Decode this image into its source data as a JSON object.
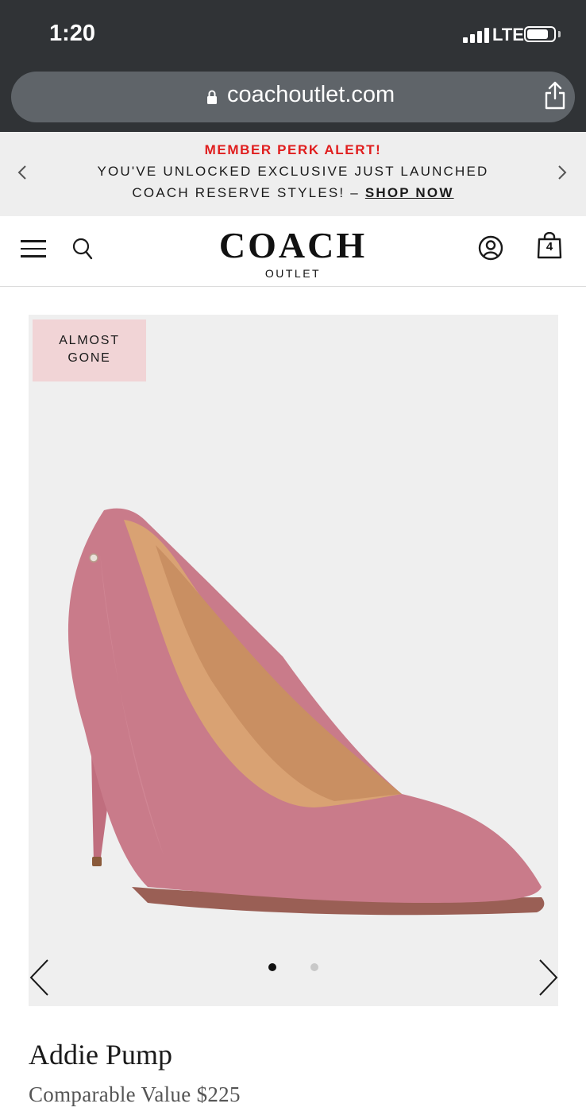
{
  "status_bar": {
    "time": "1:20",
    "network": "LTE",
    "icons": [
      "signal-icon",
      "battery-icon"
    ]
  },
  "browser": {
    "url": "coachoutlet.com",
    "icons": [
      "lock-icon",
      "share-icon"
    ]
  },
  "promo": {
    "alert": "MEMBER PERK ALERT!",
    "line1": "YOU'VE UNLOCKED EXCLUSIVE JUST LAUNCHED",
    "line2_prefix": "COACH RESERVE STYLES! – ",
    "link": "SHOP NOW",
    "icons": [
      "chevron-left-icon",
      "chevron-right-icon"
    ]
  },
  "header": {
    "logo": "COACH",
    "logo_sub": "OUTLET",
    "bag_count": "4",
    "icons": [
      "menu-icon",
      "search-icon",
      "account-icon",
      "shopping-bag-icon"
    ]
  },
  "product": {
    "badge": "ALMOST\nGONE",
    "name": "Addie Pump",
    "price_label": "Comparable Value",
    "price": "$225",
    "image_count": 2,
    "active_image": 1,
    "colors": {
      "shoe": "#c97b8a",
      "badge_bg": "#f1d4d6",
      "alert_red": "#e01e1e"
    }
  }
}
